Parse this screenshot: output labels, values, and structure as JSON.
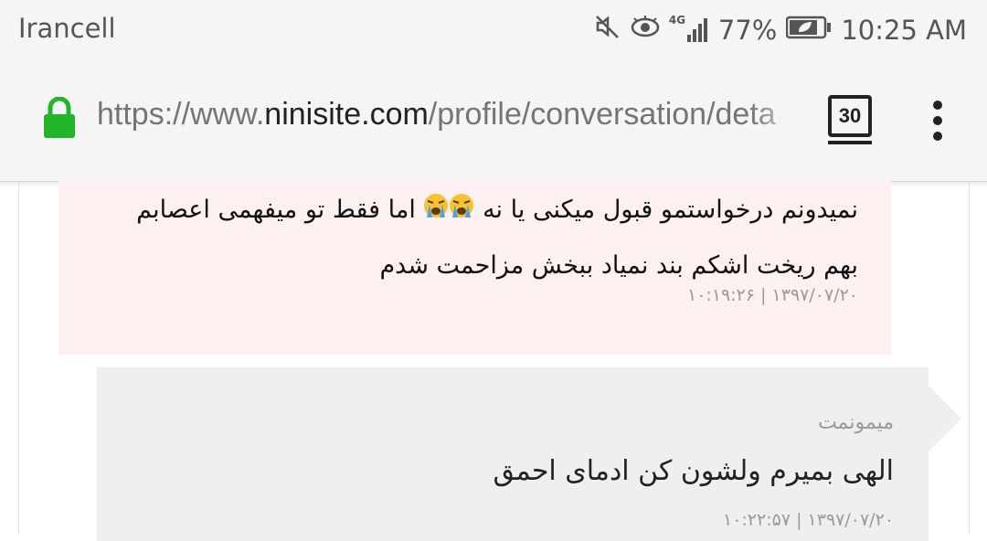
{
  "status_bar": {
    "carrier": "Irancell",
    "network": "4G",
    "battery": "77%",
    "time": "10:25 AM",
    "icons": [
      "mute-icon",
      "eye-icon",
      "signal-icon",
      "battery-icon"
    ]
  },
  "browser": {
    "url_scheme_prefix": "https://www.",
    "url_domain": "ninisite.com",
    "url_path": "/profile/conversation/deta",
    "tab_count": "30",
    "lock_color": "#22b52a"
  },
  "messages": [
    {
      "text_line1": "نمیدونم درخواستمو قبول میکنی یا نه",
      "emoji": "crying-face",
      "text_line1_end": "اما فقط تو میفهمی اعصابم",
      "text_line2": "بهم ریخت اشکم بند نمیاد ببخش مزاحمت شدم",
      "timestamp": "۱۳۹۷/۰۷/۲۰ | ۱۰:۱۹:۲۶",
      "background": "#fdf0f0"
    },
    {
      "sender": "میمونمت",
      "text": "الهی بمیرم ولشون کن ادمای احمق",
      "timestamp": "۱۳۹۷/۰۷/۲۰ | ۱۰:۲۲:۵۷",
      "background": "#efefef"
    }
  ]
}
